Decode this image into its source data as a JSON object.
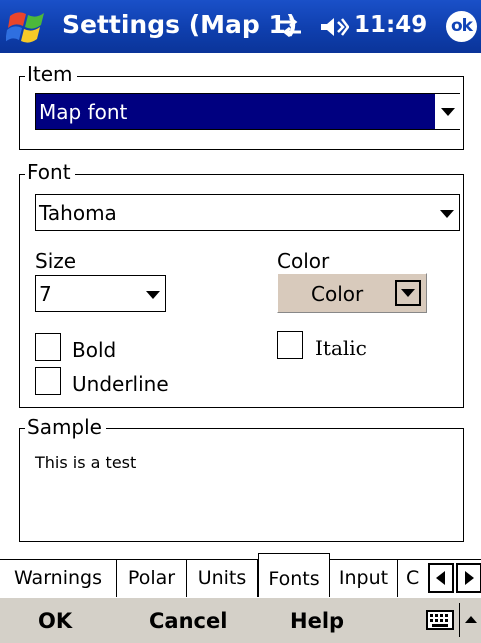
{
  "titlebar": {
    "title": "Settings (Map 1)",
    "clock": "11:49",
    "ok_label": "ok",
    "icons": [
      "windows-start-icon",
      "network-icon",
      "volume-icon"
    ],
    "bg_color": "#0f3fae"
  },
  "item_group": {
    "legend": "Item",
    "selected_value": "Map font",
    "selection_color": "#000080"
  },
  "font_group": {
    "legend": "Font",
    "font_value": "Tahoma",
    "size_label": "Size",
    "size_value": "7",
    "color_label": "Color",
    "color_button_label": "Color",
    "bold_label": "Bold",
    "italic_label": "Italic",
    "underline_label": "Underline",
    "bold_checked": false,
    "italic_checked": false,
    "underline_checked": false
  },
  "sample_group": {
    "legend": "Sample",
    "text": "This is a test"
  },
  "tabs": [
    {
      "label": "Warnings",
      "active": false
    },
    {
      "label": "Polar",
      "active": false
    },
    {
      "label": "Units",
      "active": false
    },
    {
      "label": "Fonts",
      "active": true
    },
    {
      "label": "Input",
      "active": false
    },
    {
      "label": "C",
      "active": false
    }
  ],
  "menubar": {
    "ok_label": "OK",
    "cancel_label": "Cancel",
    "help_label": "Help"
  }
}
